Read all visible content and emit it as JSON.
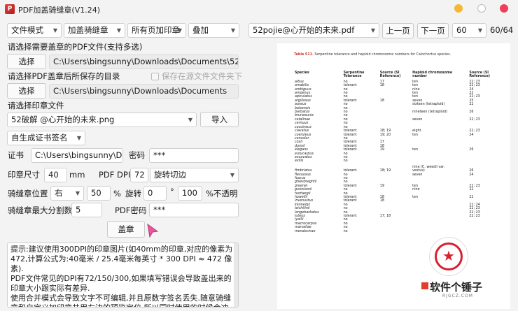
{
  "window": {
    "title": "PDF加盖骑缝章(V1.24)"
  },
  "toolbar": {
    "mode": "文件模式",
    "seal_type": "加盖骑缝章",
    "pages": "所有页加印章",
    "overlay": "叠加",
    "current_file": "52pojie@心开始的未来.pdf",
    "prev_label": "上一页",
    "next_label": "下一页",
    "page_input": "60",
    "page_indicator": "60/64"
  },
  "form": {
    "select_pdf_label": "请选择需要盖章的PDF文件(支持多选)",
    "select_btn": "选择",
    "pdf_path": "C:\\Users\\bingsunny\\Downloads\\Documents\\52pojie@心",
    "save_dir_label": "请选择PDF盖章后所保存的目录",
    "save_same_label": "保存在源文件文件夹下",
    "save_dir_path": "C:\\Users\\bingsunny\\Downloads\\Documents",
    "stamp_file_label": "请选择印章文件",
    "stamp_file": "52破解 @心开始的未来.png",
    "import_btn": "导入",
    "auto_cert": "自生成证书签名",
    "cert_label": "证书",
    "cert_path": "C:\\Users\\bingsunny\\Downlc",
    "password_label": "密码",
    "password_value": "***",
    "stamp_size_label": "印章尺寸",
    "stamp_size": "40",
    "unit_mm": "mm",
    "dpi_label": "PDF DPI",
    "dpi_value": "72",
    "rotate_cut": "旋转切边",
    "position_label": "骑缝章位置",
    "position_value": "右",
    "position_pct": "50",
    "pct_sign": "%",
    "rotate_label": "旋转",
    "rotate_value": "0",
    "degree_sign": "°",
    "opacity_value": "100",
    "opacity_label": "%不透明",
    "max_split_label": "骑缝章最大分割数",
    "max_split": "5",
    "pdf_password_label": "PDF密码",
    "pdf_password": "***",
    "stamp_btn": "盖章"
  },
  "tips": [
    "提示:建议使用300DPI的印章图片(如40mm的印章,对应的像素为472,计算公式为:40毫米 / 25.4毫米每英寸 * 300 DPI ≈ 472 像素).",
    "PDF文件常见的DPI有72/150/300,如果填写错误会导致盖出来的印章大小跟实际有差异.",
    "使用合并模式会导致文字不可编辑,并且原数字签名丢失.随意骑缝章和自定义加印章共用右边的预览定位,所以同时使用的时候会冲突"
  ],
  "preview": {
    "caption_bold": "Table S11.",
    "caption_rest": " Serpentine tolerance and haploid chromosome numbers for Calochortus species.",
    "headers": [
      "Species",
      "Serpentine Tolerance",
      "Source (SI Reference)",
      "Haploid chromosome number",
      "Source (SI Reference)"
    ],
    "rows": [
      [
        "albus",
        "no",
        "17",
        "ten",
        "22; 23"
      ],
      [
        "amabilis",
        "tolerant",
        "18",
        "ten",
        "22; 23"
      ],
      [
        "ambiguus",
        "no",
        "",
        "nine",
        "24"
      ],
      [
        "amoenus",
        "no",
        "",
        "ten",
        "22"
      ],
      [
        "apiculatus",
        "no",
        "",
        "ten",
        "22; 23"
      ],
      [
        "argillosus",
        "tolerant",
        "18",
        "seven",
        "25"
      ],
      [
        "aureus",
        "no",
        "",
        "sixteen (tetraploid)",
        "22"
      ],
      [
        "balsensis",
        "no",
        "",
        "",
        ""
      ],
      [
        "barbatus",
        "no",
        "",
        "nineteen (tetraploid)",
        "26"
      ],
      [
        "bruneaunis",
        "no",
        "",
        "",
        ""
      ],
      [
        "catalinae",
        "no",
        "",
        "seven",
        "22; 23"
      ],
      [
        "cernuus",
        "no",
        "",
        "",
        ""
      ],
      [
        "coccineus",
        "no",
        "",
        "",
        ""
      ],
      [
        "clavatus",
        "tolerant",
        "18; 19",
        "eight",
        "22; 23"
      ],
      [
        "coeruleus",
        "tolerant",
        "19; 20",
        "ten",
        "24"
      ],
      [
        "concolor",
        "no",
        "",
        "",
        ""
      ],
      [
        "coxii",
        "tolerant",
        "17",
        "",
        ""
      ],
      [
        "dunnii",
        "tolerant",
        "18",
        "",
        ""
      ],
      [
        "elegans",
        "tolerant",
        "19",
        "ten",
        "26"
      ],
      [
        "eurycarpus",
        "no",
        "",
        "",
        ""
      ],
      [
        "excavatus",
        "no",
        "",
        "",
        ""
      ],
      [
        "exilis",
        "no",
        "",
        "",
        ""
      ],
      [
        "",
        "",
        "",
        "",
        ""
      ],
      [
        "",
        "",
        "",
        "nine (C. weedii var.",
        ""
      ],
      [
        "fimbriatus",
        "tolerant",
        "18; 19",
        "vestus)",
        "26"
      ],
      [
        "flexuosus",
        "no",
        "",
        "seven",
        "24"
      ],
      [
        "fuscus",
        "no",
        "",
        "",
        ""
      ],
      [
        "ghiesbreghtii",
        "no",
        "",
        "",
        ""
      ],
      [
        "greenei",
        "tolerant",
        "19",
        "ten",
        "22; 23"
      ],
      [
        "gunnisonii",
        "no",
        "",
        "nine",
        "22"
      ],
      [
        "hartwegii",
        "no",
        "",
        "",
        ""
      ],
      [
        "howellii",
        "tolerant",
        "18",
        "ten",
        "22"
      ],
      [
        "invenustus",
        "tolerant",
        "18",
        "",
        ""
      ],
      [
        "kennedyi",
        "no",
        "",
        "",
        "22; 24"
      ],
      [
        "leichtlinii",
        "no",
        "",
        "",
        "22; 23"
      ],
      [
        "longebarbatus",
        "no",
        "",
        "",
        "22; 23"
      ],
      [
        "luteus",
        "tolerant",
        "17; 18",
        "",
        "22; 23"
      ],
      [
        "lyallii",
        "no",
        "",
        "",
        ""
      ],
      [
        "macrocarpus",
        "no",
        "",
        "",
        ""
      ],
      [
        "marcellae",
        "no",
        "",
        "",
        ""
      ],
      [
        "mendocinae",
        "no",
        "",
        "",
        ""
      ]
    ]
  },
  "branding": {
    "name": "软件个锤子",
    "url": "RJGCZ.COM"
  }
}
